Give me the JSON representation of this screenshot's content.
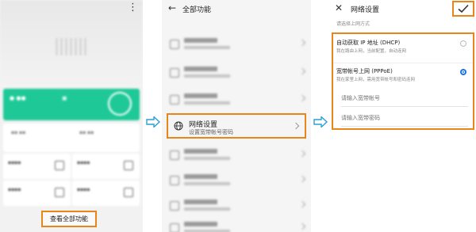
{
  "panel1": {
    "menu_icon": "more-vertical-icon",
    "view_all_label": "查看全部功能"
  },
  "panel2": {
    "title": "全部功能",
    "back_icon": "back-arrow-icon",
    "network_item": {
      "icon": "globe-icon",
      "title": "网络设置",
      "subtitle": "设置宽带帐号密码"
    }
  },
  "panel3": {
    "title": "网络设置",
    "close_icon": "close-icon",
    "confirm_icon": "check-icon",
    "subtitle": "请选择上网方式",
    "options": [
      {
        "title": "自动获取 IP 地址 (DHCP)",
        "desc": "我在路由上网，当前配置，自动连网",
        "selected": false
      },
      {
        "title": "宽带帐号上网 (PPPoE)",
        "desc": "我在家里上网，需用宽带帐号和密码连网",
        "selected": true
      }
    ],
    "account_placeholder": "请输入宽带帐号",
    "password_placeholder": "请输入宽带密码"
  },
  "colors": {
    "highlight": "#e8861a",
    "arrow": "#2a9fd6",
    "radio_selected": "#1a73e8",
    "green_card": "#1ec997"
  }
}
